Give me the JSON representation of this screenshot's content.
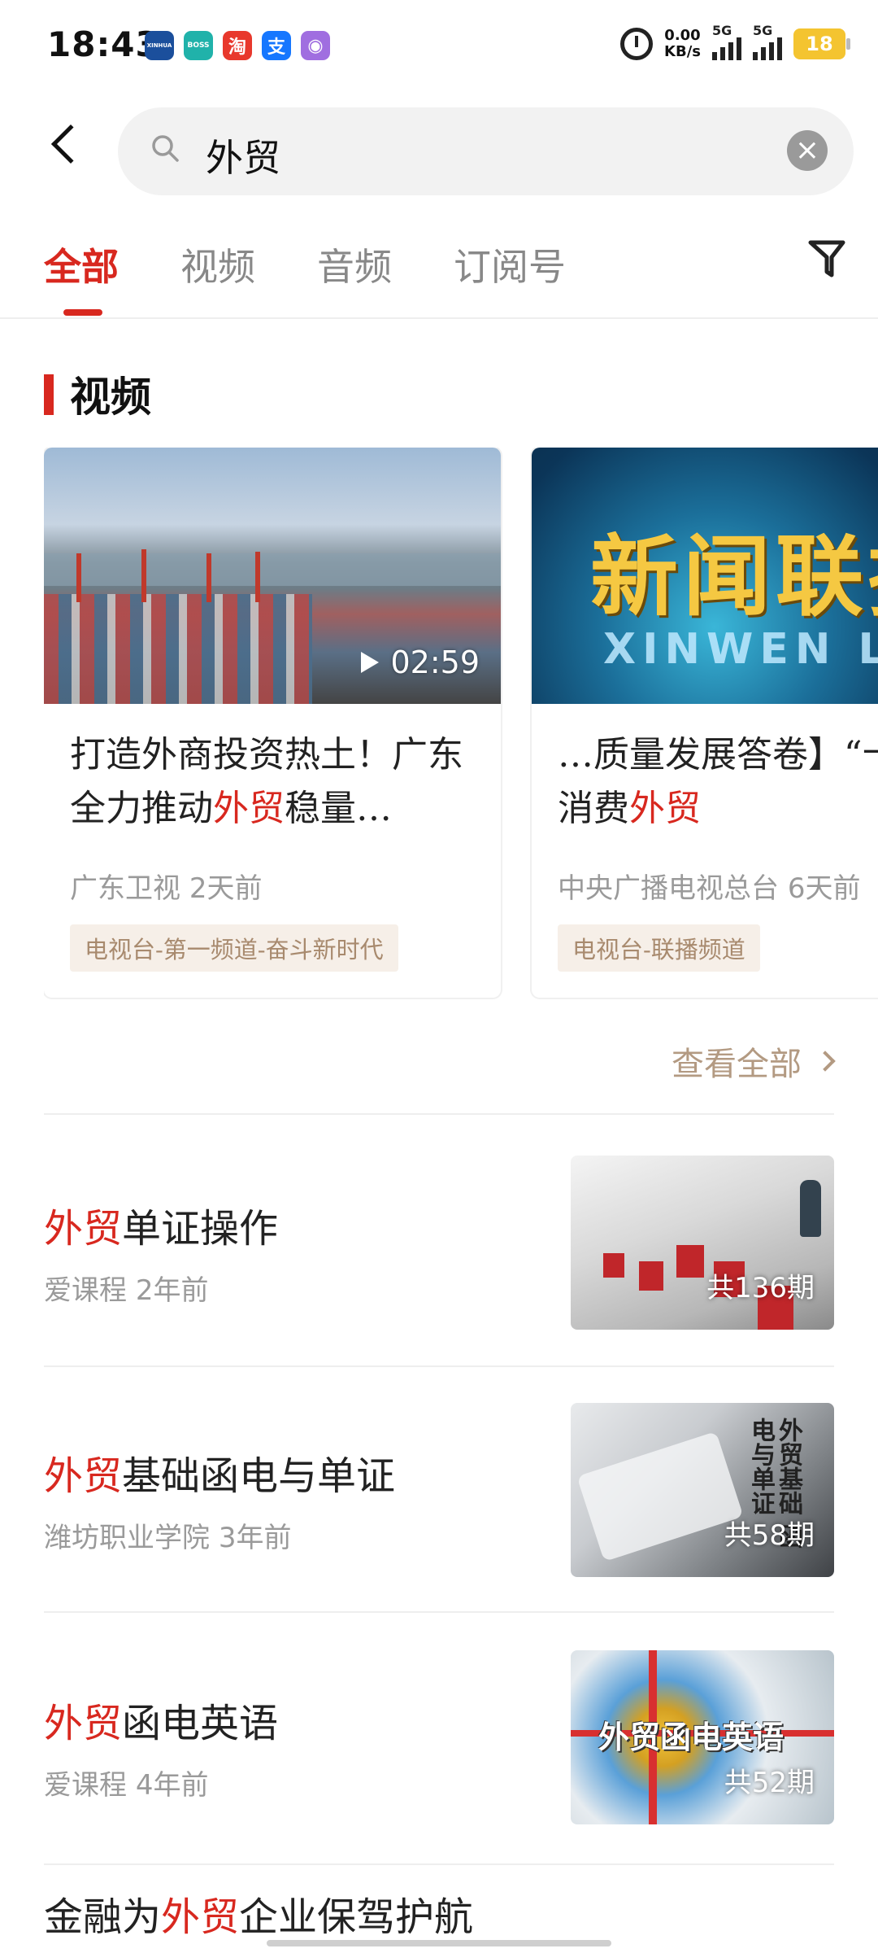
{
  "status_bar": {
    "time": "18:43",
    "net_speed_value": "0.00",
    "net_speed_unit": "KB/s",
    "sim1": "5G",
    "sim2": "5G",
    "battery": "18",
    "app_icons": [
      {
        "name": "news-app-icon",
        "label": "XINHUA",
        "color": "#1b4f9c"
      },
      {
        "name": "boss-app-icon",
        "label": "BOSS",
        "color": "#20b2aa"
      },
      {
        "name": "taobao-app-icon",
        "label": "淘",
        "color": "#e8382c"
      },
      {
        "name": "alipay-app-icon",
        "label": "支",
        "color": "#1677ff"
      },
      {
        "name": "purple-app-icon",
        "label": "◉",
        "color": "#a06ee0"
      }
    ]
  },
  "search": {
    "query": "外贸"
  },
  "tabs": [
    {
      "label": "全部",
      "active": true
    },
    {
      "label": "视频",
      "active": false
    },
    {
      "label": "音频",
      "active": false
    },
    {
      "label": "订阅号",
      "active": false
    }
  ],
  "section": {
    "title": "视频",
    "view_all": "查看全部"
  },
  "video_cards": [
    {
      "title_pre": "打造外商投资热土！广东全力推动",
      "title_hl": "外贸",
      "title_post": "稳量…",
      "source": "广东卫视",
      "time": "2天前",
      "duration": "02:59",
      "tag": "电视台-第一频道-奋斗新时代"
    },
    {
      "title_pre": "…质量发展答卷】“十四五”期间消费",
      "title_hl": "外贸",
      "title_post": "",
      "source": "中央广播电视总台",
      "time": "6天前",
      "duration": "",
      "tag": "电视台-联播频道",
      "logo_cn": "新闻联播",
      "logo_en": "XINWEN LIANBO"
    }
  ],
  "list_items": [
    {
      "title_hl": "外贸",
      "title_rest": "单证操作",
      "source": "爱课程",
      "time": "2年前",
      "episodes": "共136期"
    },
    {
      "title_hl": "外贸",
      "title_rest": "基础函电与单证",
      "source": "潍坊职业学院",
      "time": "3年前",
      "episodes": "共58期",
      "thumb_text": "外贸基础 函电与单证"
    },
    {
      "title_hl": "外贸",
      "title_rest": "函电英语",
      "source": "爱课程",
      "time": "4年前",
      "episodes": "共52期",
      "thumb_text": "外贸函电英语"
    },
    {
      "title_pre": "金融为",
      "title_hl": "外贸",
      "title_rest": "企业保驾护航"
    }
  ],
  "colors": {
    "accent": "#d8281f",
    "tag_bg": "#f6efe8",
    "tag_text": "#a88a6e",
    "meta_text": "#9a9a9a"
  }
}
